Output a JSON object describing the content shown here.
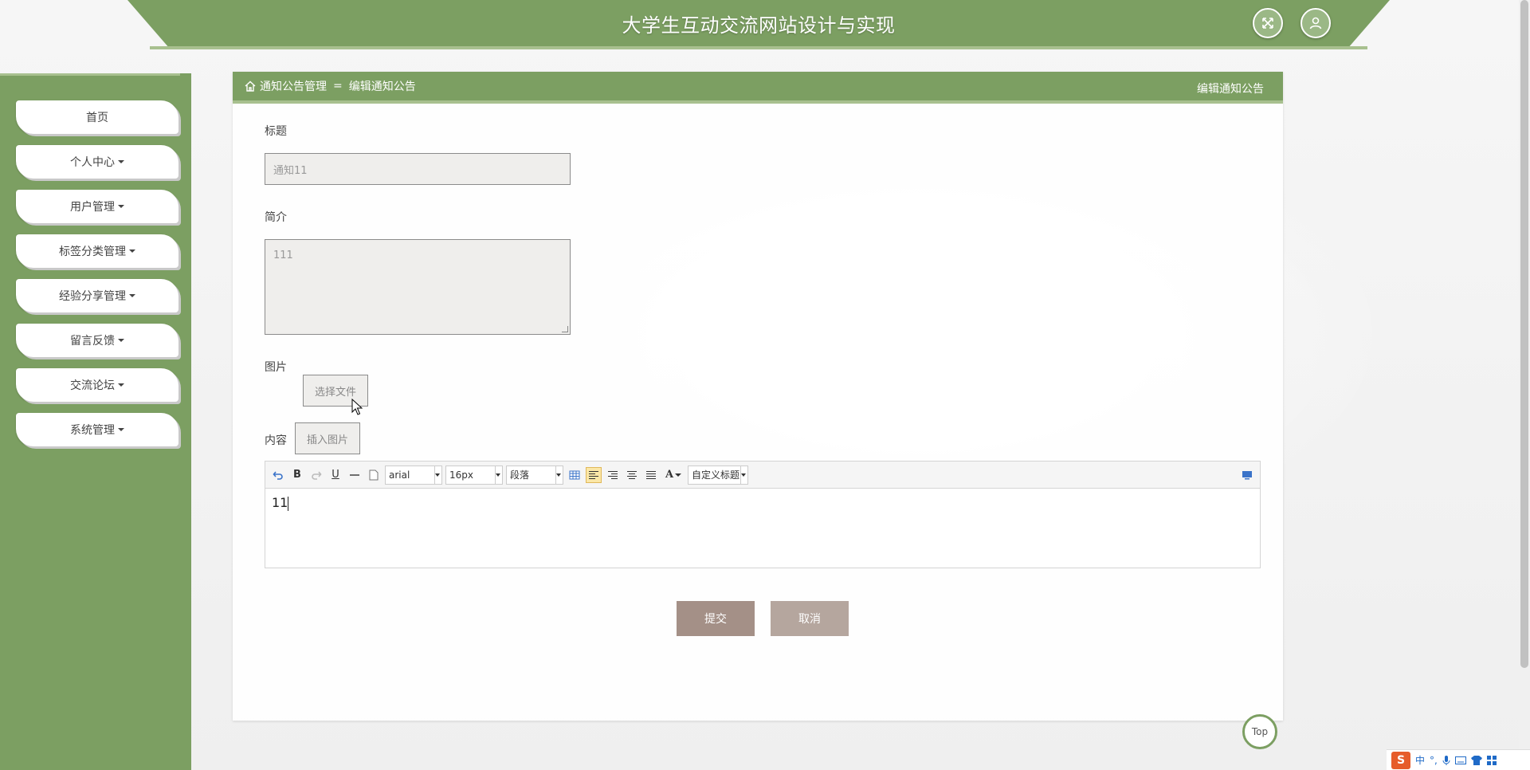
{
  "header": {
    "title": "大学生互动交流网站设计与实现",
    "fullscreen_icon": "fullscreen-icon",
    "user_icon": "user-icon"
  },
  "sidebar": {
    "items": [
      {
        "label": "首页",
        "has_caret": false
      },
      {
        "label": "个人中心",
        "has_caret": true
      },
      {
        "label": "用户管理",
        "has_caret": true
      },
      {
        "label": "标签分类管理",
        "has_caret": true
      },
      {
        "label": "经验分享管理",
        "has_caret": true
      },
      {
        "label": "留言反馈",
        "has_caret": true
      },
      {
        "label": "交流论坛",
        "has_caret": true
      },
      {
        "label": "系统管理",
        "has_caret": true
      }
    ]
  },
  "breadcrumb": {
    "parent": "通知公告管理",
    "separator": "=",
    "current": "编辑通知公告",
    "right_title": "编辑通知公告"
  },
  "form": {
    "title_label": "标题",
    "title_value": "通知11",
    "intro_label": "简介",
    "intro_value": "111",
    "image_label": "图片",
    "choose_file_label": "选择文件",
    "content_label": "内容",
    "insert_image_label": "插入图片",
    "editor": {
      "font_family": "arial",
      "font_size": "16px",
      "paragraph": "段落",
      "custom_heading": "自定义标题",
      "content": "11"
    },
    "submit_label": "提交",
    "cancel_label": "取消"
  },
  "top_button": "Top",
  "ime": {
    "lang": "中",
    "punct": "°,"
  },
  "colors": {
    "primary": "#7c9f62",
    "primary_light": "#a8c08f",
    "submit": "#a49087",
    "cancel": "#b5a69e"
  }
}
